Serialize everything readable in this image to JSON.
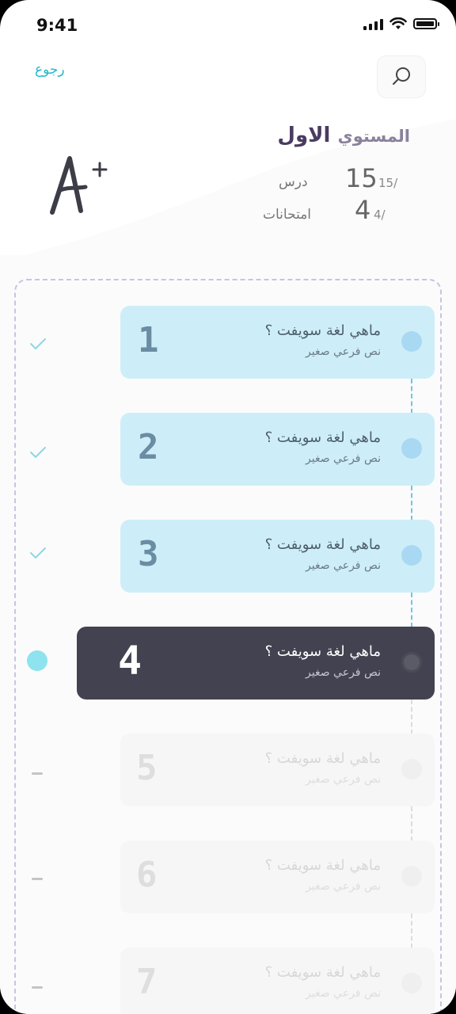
{
  "status_bar": {
    "time": "9:41"
  },
  "nav": {
    "back_label": "رجوع",
    "search_icon": "search-icon"
  },
  "header": {
    "title_prefix": "المستوي",
    "title_main": "الاول",
    "grade": "A+",
    "lessons": {
      "count": "15",
      "total": "15/",
      "label": "درس"
    },
    "exams": {
      "count": "4",
      "total": "4/",
      "label": "امتحانات"
    }
  },
  "colors": {
    "accent": "#22b8c7",
    "title": "#4a3b62",
    "done_card": "#cdeef8",
    "active_card": "#424250"
  },
  "lessons": [
    {
      "number": "1",
      "title": "ماهي لغة سويفت ؟",
      "subtitle": "نص فرعي صغير",
      "status": "done",
      "side_icon": "check-icon"
    },
    {
      "number": "2",
      "title": "ماهي لغة سويفت ؟",
      "subtitle": "نص فرعي صغير",
      "status": "done",
      "side_icon": "check-icon"
    },
    {
      "number": "3",
      "title": "ماهي لغة سويفت ؟",
      "subtitle": "نص فرعي صغير",
      "status": "done",
      "side_icon": "check-icon"
    },
    {
      "number": "4",
      "title": "ماهي لغة سويفت ؟",
      "subtitle": "نص فرعي صغير",
      "status": "active",
      "side_icon": "current-dot-icon"
    },
    {
      "number": "5",
      "title": "ماهي لغة سويفت ؟",
      "subtitle": "نص فرعي صغير",
      "status": "locked",
      "side_icon": "dash-icon"
    },
    {
      "number": "6",
      "title": "ماهي لغة سويفت ؟",
      "subtitle": "نص فرعي صغير",
      "status": "locked",
      "side_icon": "dash-icon"
    },
    {
      "number": "7",
      "title": "ماهي لغة سويفت ؟",
      "subtitle": "نص فرعي صغير",
      "status": "locked",
      "side_icon": "dash-icon"
    }
  ]
}
